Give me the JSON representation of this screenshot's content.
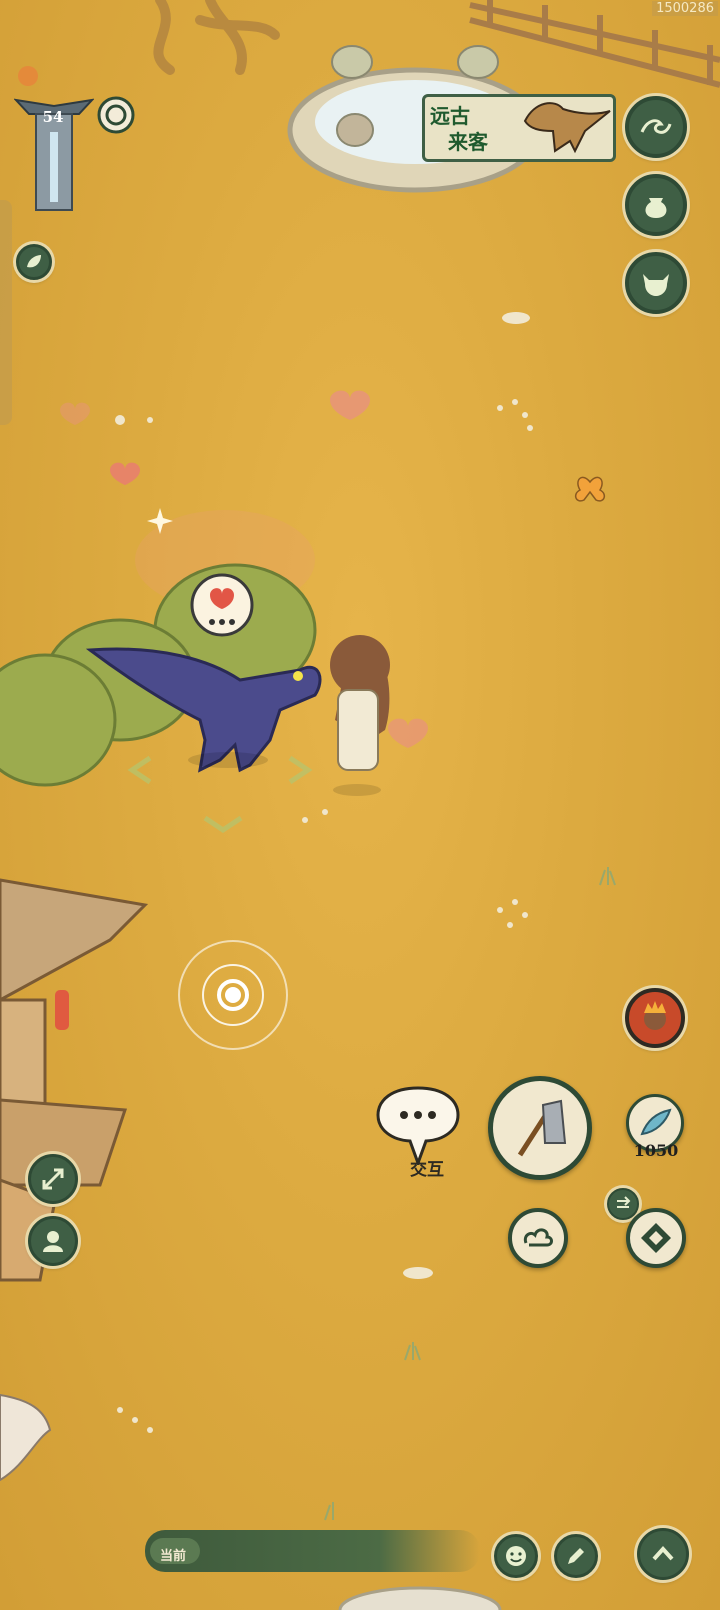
{
  "hud": {
    "uid": "1500286",
    "level": "54"
  },
  "event_banner": {
    "line1": "远古",
    "line2": "来客"
  },
  "actions": {
    "interact_label": "交互",
    "currency_amount": "1050"
  },
  "chat": {
    "channel_label": "当前"
  },
  "colors": {
    "ground": "#dcaa40",
    "button_green": "#3f5f45",
    "button_border": "#2e4a35",
    "cream": "#f1e8cf"
  }
}
